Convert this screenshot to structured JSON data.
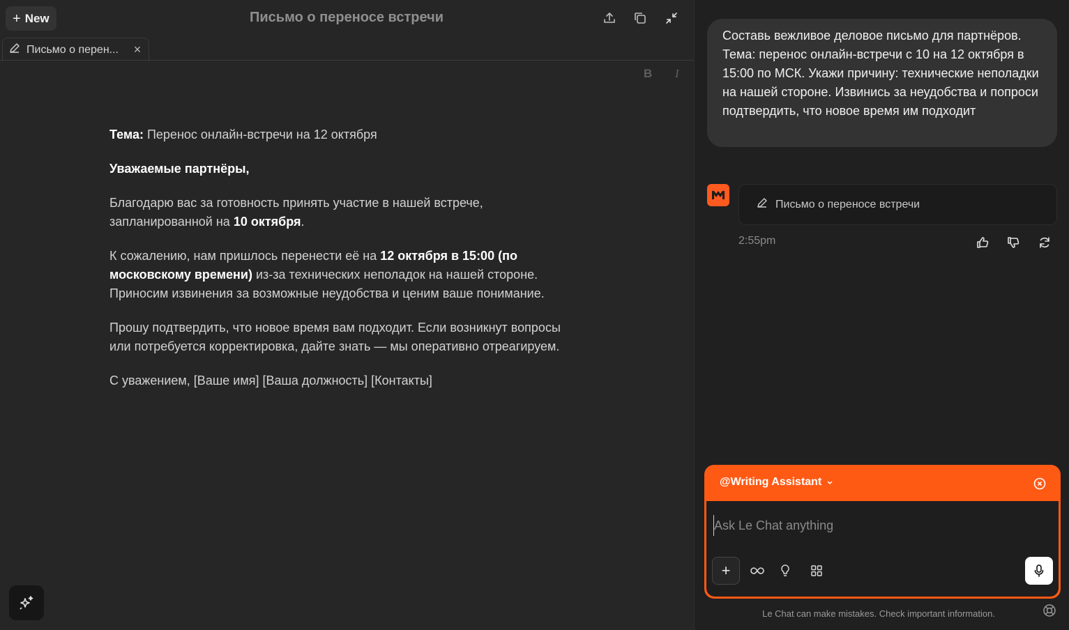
{
  "editor": {
    "new_label": "New",
    "title": "Письмо о переносе встречи",
    "tab_label": "Письмо о перен...",
    "format": {
      "bold": "B",
      "italic": "I"
    }
  },
  "document": {
    "subject_label": "Тема:",
    "subject_text": " Перенос онлайн-встречи на 12 октября",
    "greeting": "Уважаемые партнёры,",
    "p1_a": "Благодарю вас за готовность принять участие в нашей встрече, запланированной на ",
    "p1_b": "10 октября",
    "p1_c": ".",
    "p2_a": "К сожалению, нам пришлось перенести её на ",
    "p2_b": "12 октября в 15:00 (по московскому времени)",
    "p2_c": " из-за технических неполадок на нашей стороне. Приносим извинения за возможные неудобства и ценим ваше понимание.",
    "p3": "Прошу подтвердить, что новое время вам подходит. Если возникнут вопросы или потребуется корректировка, дайте знать — мы оперативно отреагируем.",
    "signoff": "С уважением, [Ваше имя] [Ваша должность] [Контакты]"
  },
  "chat": {
    "user_message": "Составь вежливое деловое письмо для партнёров. Тема: перенос онлайн-встречи с 10 на 12 октября в 15:00 по МСК. Укажи причину: технические неполадки на нашей стороне. Извинись за неудобства и попроси подтвердить, что новое время им подходит",
    "assistant_avatar": "M",
    "doc_card_label": "Письмо о переносе встречи",
    "timestamp": "2:55pm",
    "agent_label": "@Writing Assistant",
    "input_placeholder": "Ask Le Chat anything",
    "disclaimer": "Le Chat can make mistakes. Check important information."
  },
  "colors": {
    "accent": "#ff5a14",
    "panel_left": "#262626",
    "panel_right": "#202020"
  }
}
